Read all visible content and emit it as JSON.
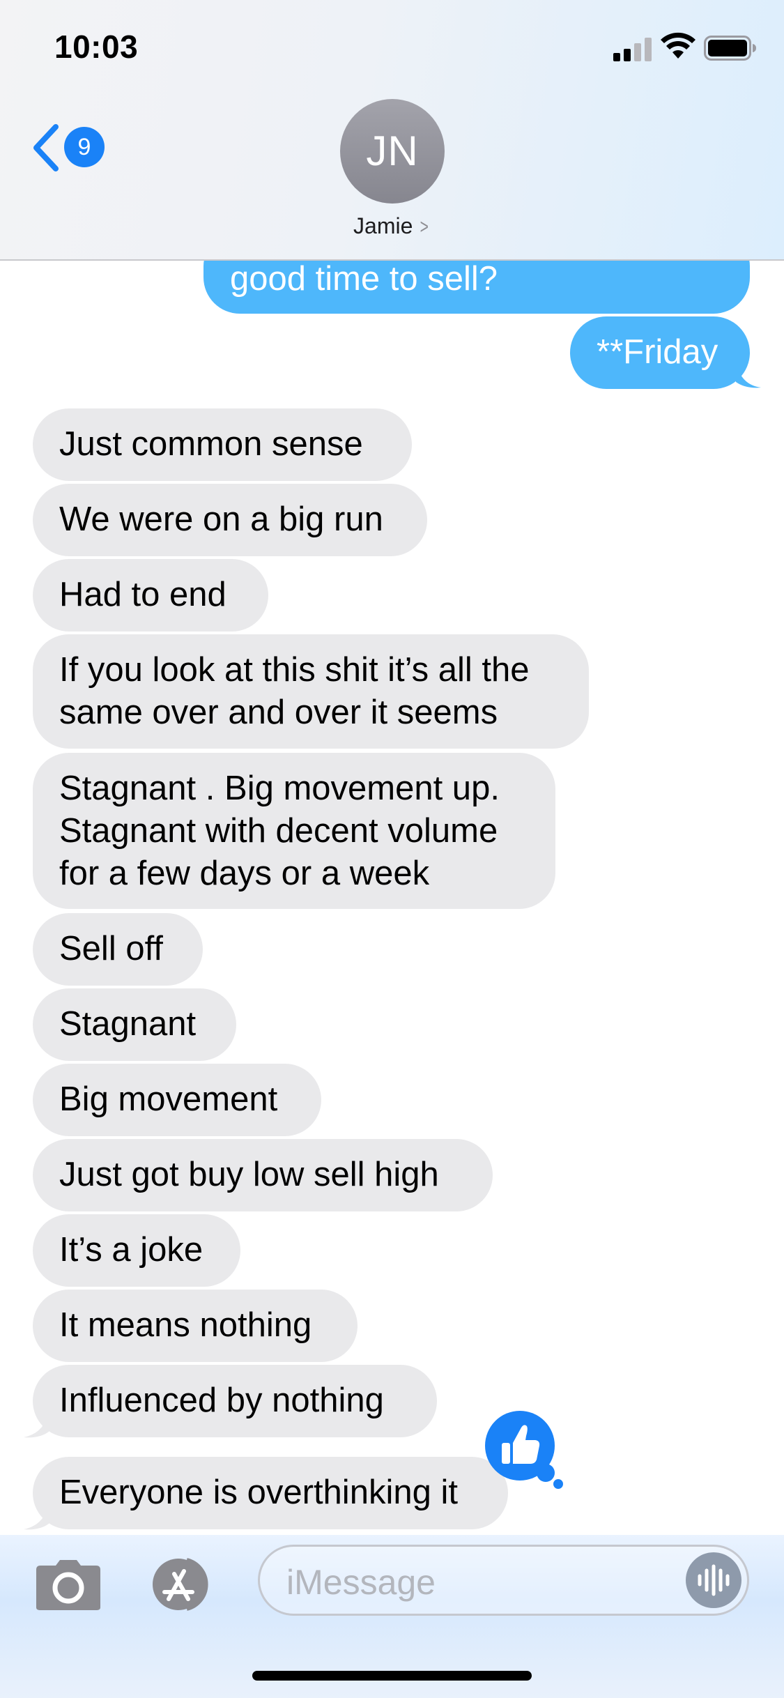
{
  "status_bar": {
    "time": "10:03"
  },
  "header": {
    "back_badge_count": "9",
    "avatar_initials": "JN",
    "contact_name": "Jamie",
    "contact_chevron": ">"
  },
  "messages": [
    {
      "direction": "outgoing",
      "text": "good time to sell?"
    },
    {
      "direction": "outgoing",
      "text": "**Friday"
    },
    {
      "direction": "incoming",
      "text": "Just common sense"
    },
    {
      "direction": "incoming",
      "text": "We were on a big run"
    },
    {
      "direction": "incoming",
      "text": "Had to end"
    },
    {
      "direction": "incoming",
      "lines": [
        "If you look at this shit it’s all the",
        "same over and over it seems"
      ]
    },
    {
      "direction": "incoming",
      "lines": [
        "Stagnant . Big movement up.",
        "Stagnant with decent volume",
        "for a few days or a week"
      ]
    },
    {
      "direction": "incoming",
      "text": "Sell off"
    },
    {
      "direction": "incoming",
      "text": "Stagnant"
    },
    {
      "direction": "incoming",
      "text": "Big movement"
    },
    {
      "direction": "incoming",
      "text": "Just got buy low sell high"
    },
    {
      "direction": "incoming",
      "text": "It’s a joke"
    },
    {
      "direction": "incoming",
      "text": "It means nothing"
    },
    {
      "direction": "incoming",
      "text": "Influenced by nothing"
    },
    {
      "direction": "incoming",
      "text": "Everyone is overthinking it",
      "tapback": "thumbs-up-icon"
    }
  ],
  "compose": {
    "placeholder": "iMessage"
  },
  "colors": {
    "outgoing_bubble": "#4eb7fb",
    "incoming_bubble": "#e9e9eb",
    "accent": "#1a82f7"
  }
}
